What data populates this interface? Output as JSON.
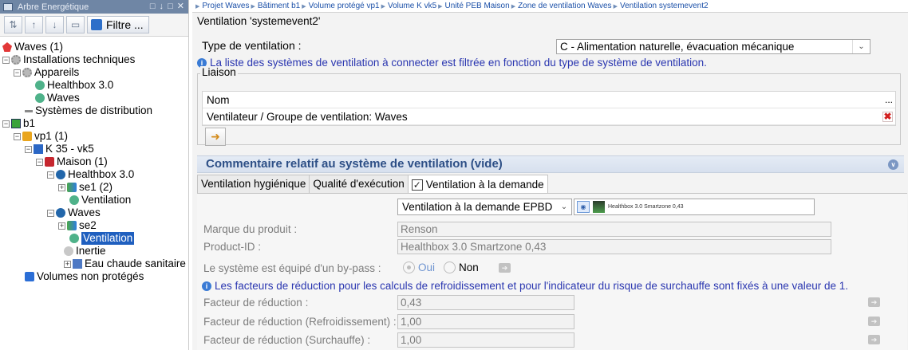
{
  "left_panel": {
    "title": "Arbre Energétique",
    "window_controls": "□ ↓ □ ✕",
    "filter_label": "Filtre ...",
    "tree": [
      {
        "label": "Waves (1)",
        "icon": "waves-icon"
      },
      {
        "label": "Installations techniques",
        "icon": "gear-icon"
      },
      {
        "label": "Appareils",
        "icon": "gear-icon"
      },
      {
        "label": "Healthbox 3.0",
        "icon": "fan-icon"
      },
      {
        "label": "Waves",
        "icon": "fan-icon"
      },
      {
        "label": "Systèmes de distribution",
        "icon": "distribution-icon"
      },
      {
        "label": "b1",
        "icon": "building-icon"
      },
      {
        "label": "vp1 (1)",
        "icon": "volume-icon"
      },
      {
        "label": "K 35 - vk5",
        "icon": "k-volume-icon"
      },
      {
        "label": "Maison (1)",
        "icon": "house-icon"
      },
      {
        "label": "Healthbox 3.0",
        "icon": "healthbox-icon"
      },
      {
        "label": "se1 (2)",
        "icon": "system-icon"
      },
      {
        "label": "Ventilation",
        "icon": "fan-icon"
      },
      {
        "label": "Waves",
        "icon": "healthbox-icon"
      },
      {
        "label": "se2",
        "icon": "system-icon"
      },
      {
        "label": "Ventilation",
        "icon": "fan-icon"
      },
      {
        "label": "Inertie",
        "icon": "inertia-icon"
      },
      {
        "label": "Eau chaude sanitaire",
        "icon": "hot-water-icon"
      },
      {
        "label": "Volumes non protégés",
        "icon": "unprotected-volume-icon"
      }
    ]
  },
  "breadcrumb": [
    "Projet Waves",
    "Bâtiment b1",
    "Volume protégé vp1",
    "Volume K vk5",
    "Unité PEB Maison",
    "Zone de ventilation Waves",
    "Ventilation systemevent2"
  ],
  "main": {
    "section_title": "Ventilation 'systemevent2'",
    "type_label": "Type de ventilation :",
    "type_value": "C - Alimentation naturelle, évacuation mécanique",
    "info_filter": "La liste des systèmes de ventilation à connecter est filtrée en fonction du type de système de ventilation.",
    "liaison_legend": "Liaison",
    "liaison_header": "Nom",
    "liaison_header_more": "...",
    "liaison_row": "Ventilateur / Groupe de ventilation: Waves",
    "comment_bar": "Commentaire relatif au système de ventilation (vide)",
    "tabs": [
      "Ventilation hygiénique",
      "Qualité d'exécution",
      "Ventilation à la demande"
    ],
    "demand_select": "Ventilation à la demande EPBD",
    "demand_product": "Healthbox 3.0 Smartzone 0,43",
    "brand_label": "Marque du produit :",
    "brand_value": "Renson",
    "product_id_label": "Product-ID :",
    "product_id_value": "Healthbox 3.0 Smartzone 0,43",
    "bypass_label": "Le système est équipé d'un by-pass :",
    "bypass_yes": "Oui",
    "bypass_no": "Non",
    "info_reduction": "Les facteurs de réduction pour les calculs de refroidissement et pour l'indicateur du risque de surchauffe sont fixés à une valeur de 1.",
    "factor_label": "Facteur de réduction :",
    "factor_value": "0,43",
    "factor_cool_label": "Facteur de réduction (Refroidissement) :",
    "factor_cool_value": "1,00",
    "factor_heat_label": "Facteur de réduction (Surchauffe) :",
    "factor_heat_value": "1,00"
  }
}
